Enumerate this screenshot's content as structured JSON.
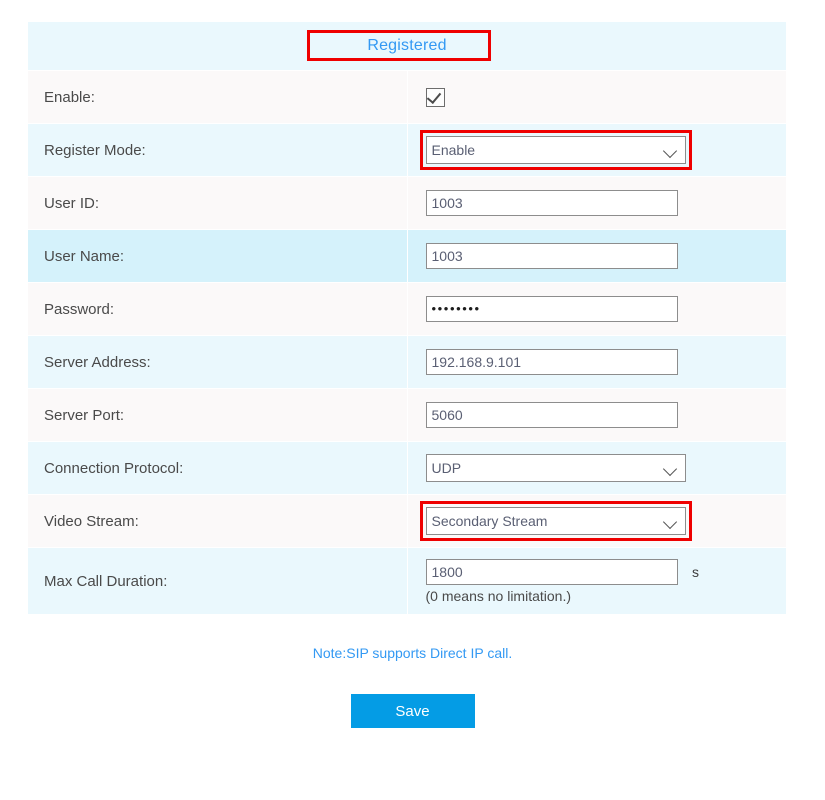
{
  "status": {
    "label": "Registered",
    "color": "#3399f3",
    "highlight_color": "#ef0000"
  },
  "form": {
    "rows": [
      {
        "label": "Enable:",
        "type": "checkbox",
        "value": "checked",
        "highlighted": false
      },
      {
        "label": "Register Mode:",
        "type": "select",
        "value": "Enable",
        "highlighted": true
      },
      {
        "label": "User ID:",
        "type": "text",
        "value": "1003",
        "highlighted": false
      },
      {
        "label": "User Name:",
        "type": "text",
        "value": "1003",
        "highlighted": false
      },
      {
        "label": "Password:",
        "type": "password",
        "value": "••••••••",
        "highlighted": false
      },
      {
        "label": "Server Address:",
        "type": "text",
        "value": "192.168.9.101",
        "highlighted": false
      },
      {
        "label": "Server Port:",
        "type": "text",
        "value": "5060",
        "highlighted": false
      },
      {
        "label": "Connection Protocol:",
        "type": "select",
        "value": "UDP",
        "highlighted": false
      },
      {
        "label": "Video Stream:",
        "type": "select",
        "value": "Secondary Stream",
        "highlighted": true
      },
      {
        "label": "Max Call Duration:",
        "type": "text",
        "value": "1800",
        "unit": "s",
        "hint": "(0 means no limitation.)",
        "highlighted": false
      }
    ]
  },
  "footer": {
    "note": "Note:SIP supports Direct IP call.",
    "save_label": "Save",
    "save_color": "#049ce5"
  },
  "icons": {
    "check": "check-icon",
    "caret": "chevron-down-icon"
  }
}
